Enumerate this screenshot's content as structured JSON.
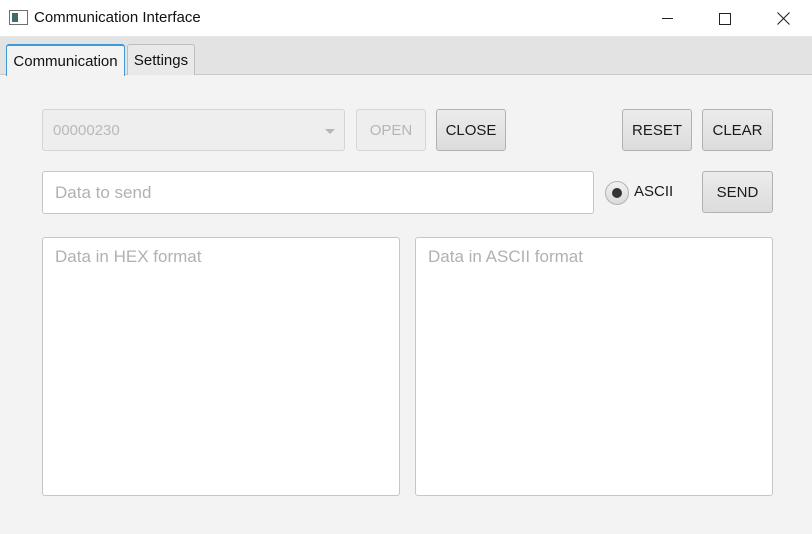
{
  "window": {
    "title": "Communication Interface"
  },
  "tabs": [
    {
      "label": "Communication",
      "active": true
    },
    {
      "label": "Settings",
      "active": false
    }
  ],
  "port": {
    "selected": "00000230",
    "enabled": false
  },
  "buttons": {
    "open": "OPEN",
    "close": "CLOSE",
    "reset": "RESET",
    "clear": "CLEAR",
    "send": "SEND"
  },
  "send_field": {
    "placeholder": "Data to send",
    "value": ""
  },
  "format_radio": {
    "label": "ASCII",
    "selected": true
  },
  "hex_area": {
    "placeholder": "Data in HEX format"
  },
  "ascii_area": {
    "placeholder": "Data in ASCII format"
  },
  "icons": [
    "app-icon",
    "minimize-icon",
    "maximize-icon",
    "close-icon",
    "chevron-down-icon"
  ],
  "colors": {
    "tab_accent": "#3c9ad8",
    "background": "#f3f3f3"
  }
}
